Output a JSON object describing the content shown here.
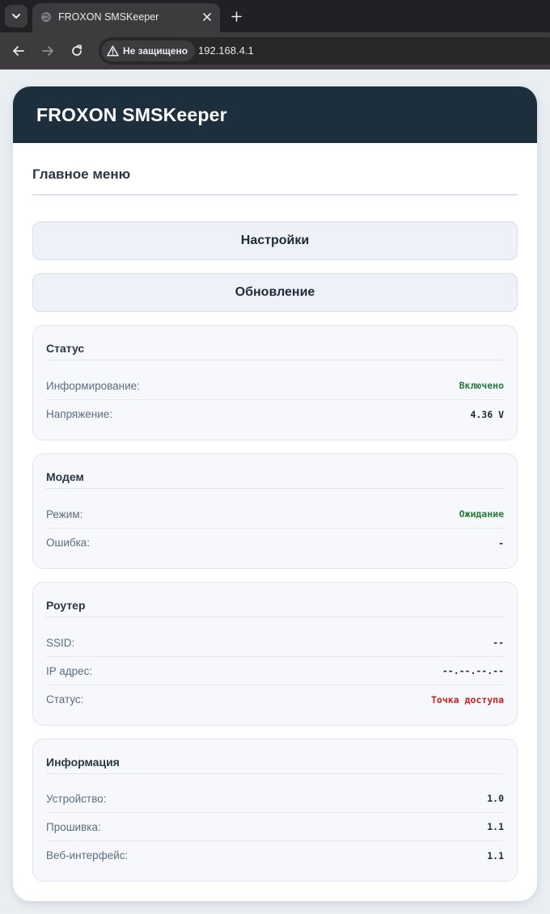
{
  "browser": {
    "tab_title": "FROXON SMSKeeper",
    "security_label": "Не защищено",
    "url": "192.168.4.1"
  },
  "app": {
    "title": "FROXON SMSKeeper",
    "section_title": "Главное меню",
    "buttons": {
      "settings": "Настройки",
      "update": "Обновление"
    }
  },
  "panels": {
    "status": {
      "title": "Статус",
      "rows": [
        {
          "label": "Информирование:",
          "value": "Включено"
        },
        {
          "label": "Напряжение:",
          "value": "4.36 V"
        }
      ]
    },
    "modem": {
      "title": "Модем",
      "rows": [
        {
          "label": "Режим:",
          "value": "Ожидание"
        },
        {
          "label": "Ошибка:",
          "value": "-"
        }
      ]
    },
    "router": {
      "title": "Роутер",
      "rows": [
        {
          "label": "SSID:",
          "value": "--"
        },
        {
          "label": "IP адрес:",
          "value": "--.--.--.--"
        },
        {
          "label": "Статус:",
          "value": "Точка доступа"
        }
      ]
    },
    "info": {
      "title": "Информация",
      "rows": [
        {
          "label": "Устройство:",
          "value": "1.0"
        },
        {
          "label": "Прошивка:",
          "value": "1.1"
        },
        {
          "label": "Веб-интерфейс:",
          "value": "1.1"
        }
      ]
    }
  },
  "colors": {
    "header_bg": "#1d2f3d",
    "value_ok": "#2b7a3b",
    "value_alert": "#cc1f1f"
  }
}
